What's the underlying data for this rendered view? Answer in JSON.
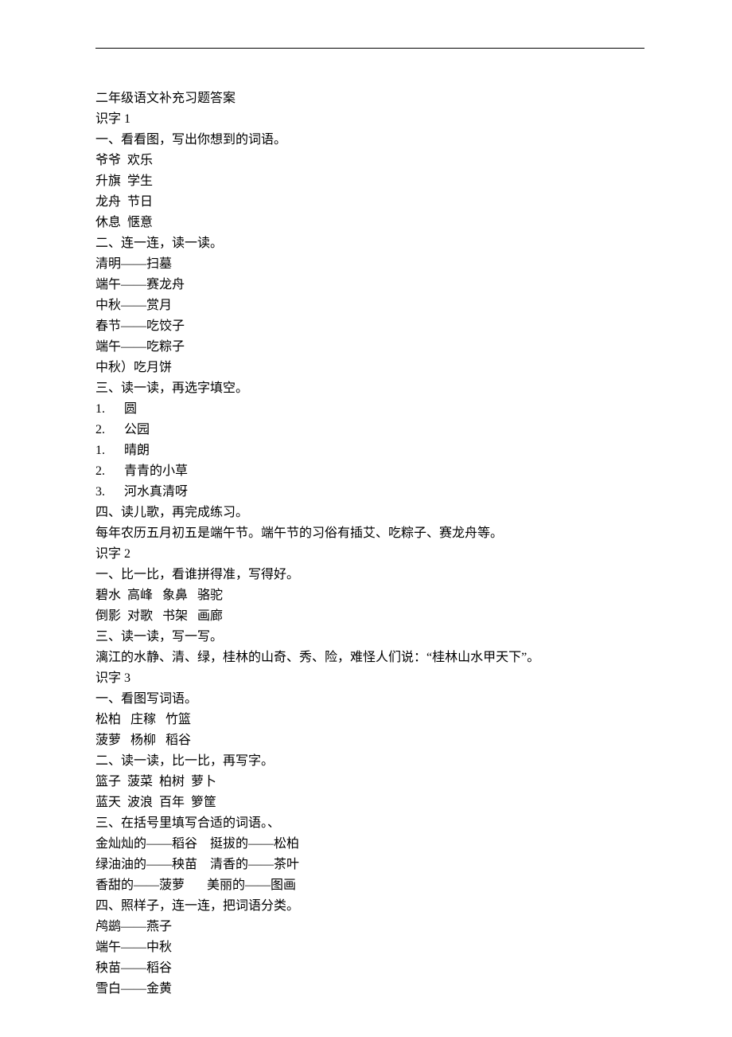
{
  "lines": [
    "二年级语文补充习题答案",
    "识字 1",
    "一、看看图，写出你想到的词语。",
    "爷爷  欢乐",
    "升旗  学生",
    "龙舟  节日",
    "休息  惬意",
    "二、连一连，读一读。",
    "清明——扫墓",
    "端午——赛龙舟",
    "中秋——赏月",
    "春节——吃饺子",
    "端午——吃粽子",
    "中秋）吃月饼",
    "三、读一读，再选字填空。",
    "1.      圆",
    "2.      公园",
    "1.      晴朗",
    "2.      青青的小草",
    "3.      河水真清呀",
    "四、读儿歌，再完成练习。",
    "每年农历五月初五是端午节。端午节的习俗有插艾、吃粽子、赛龙舟等。",
    "识字 2",
    "一、比一比，看谁拼得准，写得好。",
    "碧水  高峰   象鼻   骆驼",
    "倒影  对歌   书架   画廊",
    "三、读一读，写一写。",
    "漓江的水静、清、绿，桂林的山奇、秀、险，难怪人们说：“桂林山水甲天下”。",
    "识字 3",
    "一、看图写词语。",
    "松柏   庄稼   竹篮",
    "菠萝   杨柳   稻谷",
    "二、读一读，比一比，再写字。",
    "篮子  菠菜  柏树  萝卜",
    "蓝天  波浪  百年  箩筐",
    "三、在括号里填写合适的词语。、",
    "金灿灿的——稻谷    挺拔的——松柏",
    "绿油油的——秧苗    清香的——茶叶",
    "香甜的——菠萝       美丽的——图画",
    "四、照样子，连一连，把词语分类。",
    "鸬鹚——燕子",
    "端午——中秋",
    "秧苗——稻谷",
    "雪白——金黄"
  ]
}
